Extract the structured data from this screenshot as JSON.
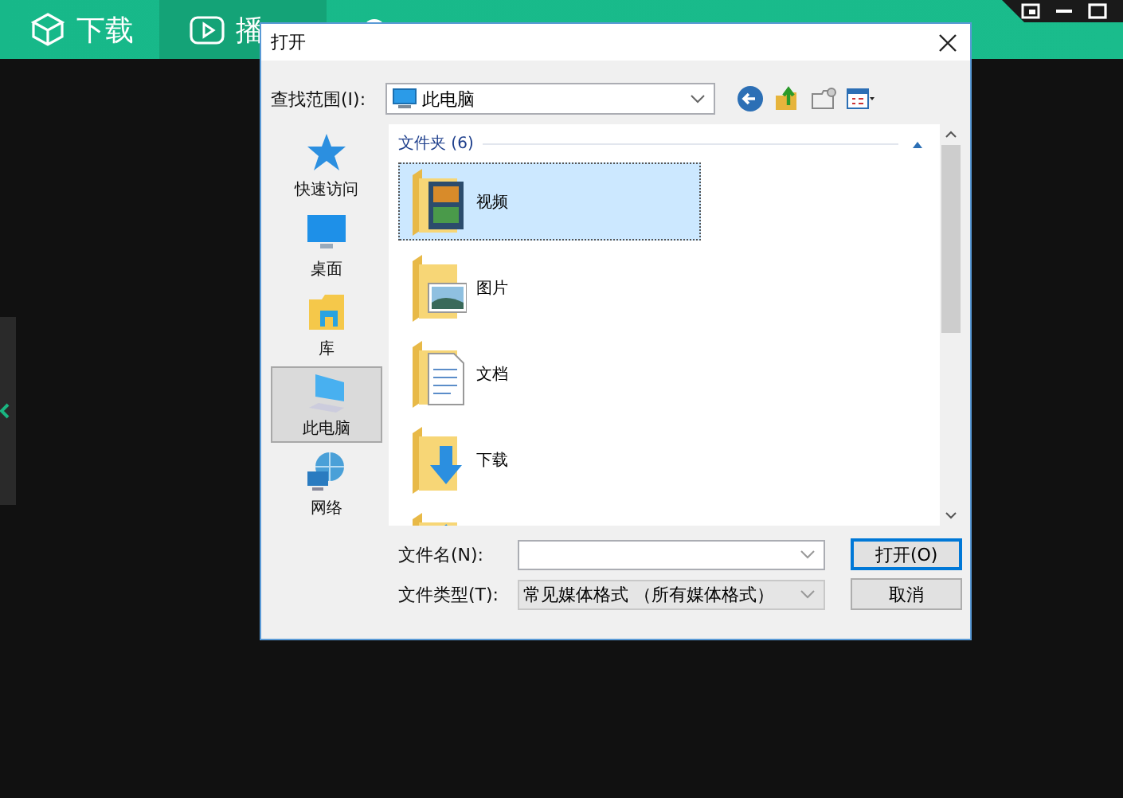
{
  "app": {
    "tabs": [
      {
        "label": "下载",
        "selected": false
      },
      {
        "label": "播",
        "selected": true
      },
      {
        "selected": false
      }
    ]
  },
  "dialog": {
    "title": "打开",
    "look_in": {
      "label": "查找范围(I):",
      "value": "此电脑"
    },
    "places": [
      {
        "label": "快速访问",
        "kind": "star",
        "selected": false
      },
      {
        "label": "桌面",
        "kind": "desktop",
        "selected": false
      },
      {
        "label": "库",
        "kind": "library",
        "selected": false
      },
      {
        "label": "此电脑",
        "kind": "computer",
        "selected": true
      },
      {
        "label": "网络",
        "kind": "network",
        "selected": false
      }
    ],
    "group": {
      "label": "文件夹 (6)",
      "expanded": true
    },
    "items": [
      {
        "label": "视频",
        "kind": "video",
        "selected": true
      },
      {
        "label": "图片",
        "kind": "picture",
        "selected": false
      },
      {
        "label": "文档",
        "kind": "document",
        "selected": false
      },
      {
        "label": "下载",
        "kind": "download",
        "selected": false
      },
      {
        "kind": "music",
        "selected": false
      }
    ],
    "file_name": {
      "label": "文件名(N):"
    },
    "file_type": {
      "label": "文件类型(T):",
      "value": "常见媒体格式 （所有媒体格式）"
    },
    "buttons": [
      {
        "label": "打开(O)",
        "default": true
      },
      {
        "label": "取消",
        "default": false
      }
    ]
  }
}
